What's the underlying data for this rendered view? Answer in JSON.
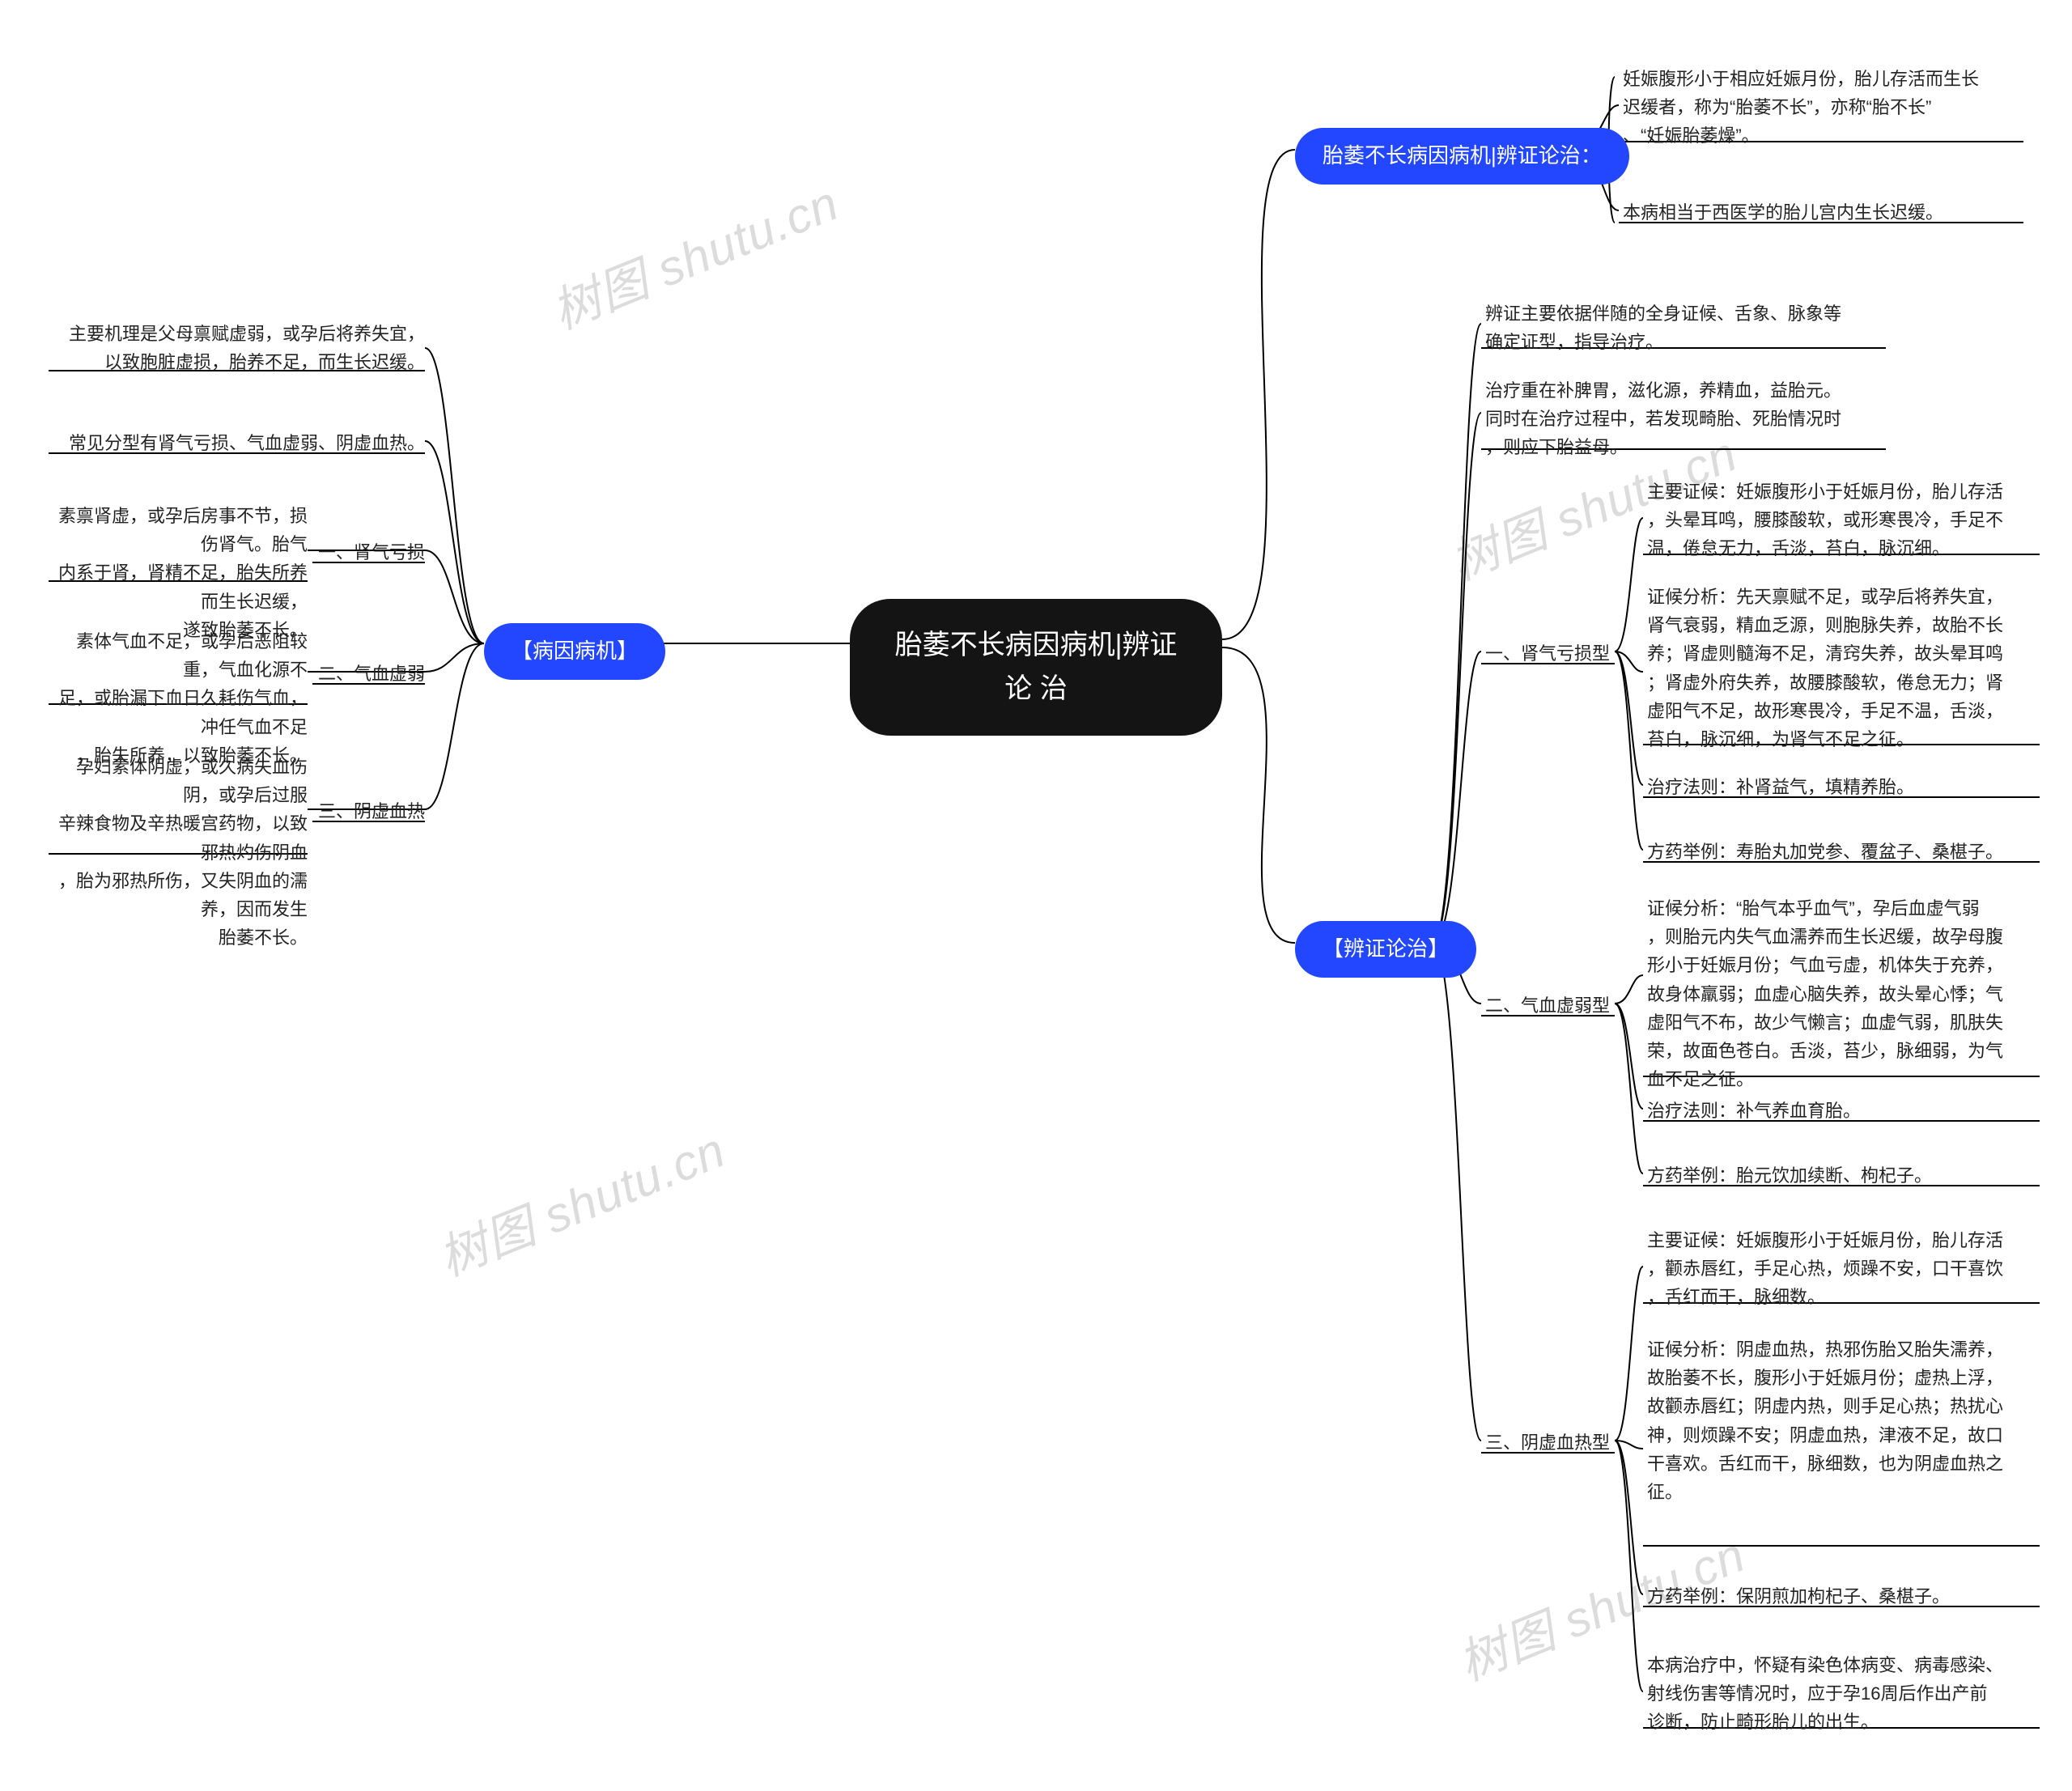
{
  "root": "胎萎不长病因病机|辨证论\n治",
  "leftBranch": {
    "pill": "【病因病机】",
    "items": [
      {
        "label": "主要机理是父母禀赋虚弱，或孕后将养失宜，\n以致胞脏虚损，胎养不足，而生长迟缓。"
      },
      {
        "label": "常见分型有肾气亏损、气血虚弱、阴虚血热。"
      },
      {
        "tag": "一、肾气亏损",
        "label": "素禀肾虚，或孕后房事不节，损伤肾气。胎气\n内系于肾，肾精不足，胎失所养而生长迟缓，\n遂致胎萎不长。"
      },
      {
        "tag": "二、气血虚弱",
        "label": "素体气血不足，或孕后恶阻较重，气血化源不\n足，或胎漏下血日久耗伤气血，冲任气血不足\n，胎失所养，以致胎萎不长。"
      },
      {
        "tag": "三、阴虚血热",
        "label": "孕妇素体阴虚，或久病失血伤阴，或孕后过服\n辛辣食物及辛热暖宫药物，以致邪热灼伤阴血\n，胎为邪热所伤，又失阴血的濡养，因而发生\n胎萎不长。"
      }
    ]
  },
  "rightTop": {
    "pill": "胎萎不长病因病机|辨证论治：",
    "items": [
      "妊娠腹形小于相应妊娠月份，胎儿存活而生长\n迟缓者，称为“胎萎不长”，亦称“胎不长”\n、“妊娠胎萎燥”。",
      "本病相当于西医学的胎儿宫内生长迟缓。"
    ]
  },
  "rightMain": {
    "pill": "【辨证论治】",
    "intro": [
      "辨证主要依据伴随的全身证候、舌象、脉象等\n确定证型，指导治疗。",
      "治疗重在补脾胃，滋化源，养精血，益胎元。\n同时在治疗过程中，若发现畸胎、死胎情况时\n，则应下胎益母。"
    ],
    "types": [
      {
        "tag": "一、肾气亏损型",
        "items": [
          "主要证候：妊娠腹形小于妊娠月份，胎儿存活\n，头晕耳鸣，腰膝酸软，或形寒畏冷，手足不\n温，倦怠无力，舌淡，苔白，脉沉细。",
          "证候分析：先天禀赋不足，或孕后将养失宜，\n肾气衰弱，精血乏源，则胞脉失养，故胎不长\n养；肾虚则髓海不足，清窍失养，故头晕耳鸣\n；肾虚外府失养，故腰膝酸软，倦怠无力；肾\n虚阳气不足，故形寒畏冷，手足不温，舌淡，\n苔白，脉沉细，为肾气不足之征。",
          "治疗法则：补肾益气，填精养胎。",
          "方药举例：寿胎丸加党参、覆盆子、桑椹子。"
        ]
      },
      {
        "tag": "二、气血虚弱型",
        "items": [
          "证候分析：“胎气本乎血气”，孕后血虚气弱\n，则胎元内失气血濡养而生长迟缓，故孕母腹\n形小于妊娠月份；气血亏虚，机体失于充养，\n故身体羸弱；血虚心脑失养，故头晕心悸；气\n虚阳气不布，故少气懒言；血虚气弱，肌肤失\n荣，故面色苍白。舌淡，苔少，脉细弱，为气\n血不足之征。",
          "治疗法则：补气养血育胎。",
          "方药举例：胎元饮加续断、枸杞子。"
        ]
      },
      {
        "tag": "三、阴虚血热型",
        "items": [
          "主要证候：妊娠腹形小于妊娠月份，胎儿存活\n，颧赤唇红，手足心热，烦躁不安，口干喜饮\n，舌红而干，脉细数。",
          "证候分析：阴虚血热，热邪伤胎又胎失濡养，\n故胎萎不长，腹形小于妊娠月份；虚热上浮，\n故颧赤唇红；阴虚内热，则手足心热；热扰心\n神，则烦躁不安；阴虚血热，津液不足，故口\n干喜欢。舌红而干，脉细数，也为阴虚血热之\n征。",
          "方药举例：保阴煎加枸杞子、桑椹子。",
          "本病治疗中，怀疑有染色体病变、病毒感染、\n射线伤害等情况时，应于孕16周后作出产前\n诊断，防止畸形胎儿的出生。"
        ]
      }
    ]
  },
  "watermark": "树图 shutu.cn"
}
